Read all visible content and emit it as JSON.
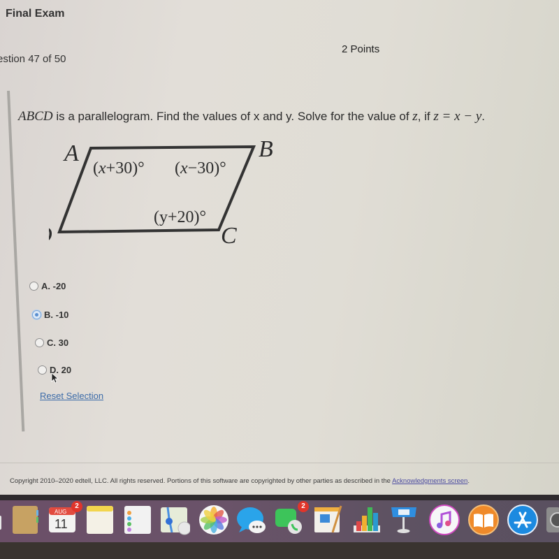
{
  "header": {
    "exam_title": "Final Exam",
    "question_count": "estion 47 of 50",
    "points": "2 Points"
  },
  "question": {
    "math_prefix": "ABCD",
    "text_main": " is a parallelogram. Find the values of x and y. Solve for the value of ",
    "math_z": "z",
    "text_if": ", if ",
    "math_equation": "z = x − y",
    "text_end": "."
  },
  "diagram": {
    "vertices": {
      "a": "A",
      "b": "B",
      "c": "C",
      "d": "D"
    },
    "angles": {
      "a": {
        "open": "(",
        "var": "x",
        "rest": "+30)°"
      },
      "b": {
        "open": "(",
        "var": "x",
        "rest": "−30)°"
      },
      "c": {
        "text": "(y+20)°"
      }
    }
  },
  "options": [
    {
      "label": "A. -20",
      "selected": false
    },
    {
      "label": "B. -10",
      "selected": true
    },
    {
      "label": "C. 30",
      "selected": false
    },
    {
      "label": "D. 20",
      "selected": false
    }
  ],
  "reset_label": "Reset Selection",
  "footer": {
    "copyright": "Copyright 2010–2020 edtell, LLC. All rights reserved. Portions of this software are copyrighted by other parties as described in the ",
    "link": "Acknowledgments screen",
    "end": "."
  },
  "dock": {
    "calendar_month": "AUG",
    "calendar_day": "11",
    "calendar_badge": "2",
    "facetime_badge": "2",
    "apps": [
      "contacts",
      "calendar",
      "notes",
      "reminders",
      "maps",
      "photos",
      "messages",
      "facetime",
      "pages",
      "numbers",
      "keynote",
      "itunes",
      "ibooks",
      "app-store",
      "system-preferences"
    ]
  },
  "colors": {
    "selected_radio": "#5b8fd0",
    "link": "#3a6aa8",
    "dock": "#6a5369",
    "badge": "#e0352b"
  }
}
